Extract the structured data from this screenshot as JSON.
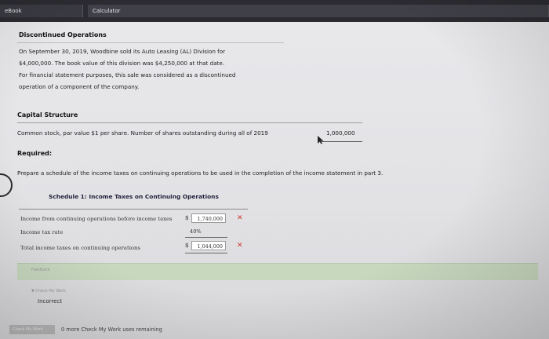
{
  "tabs": {
    "ebook": "eBook",
    "calculator": "Calculator"
  },
  "discontinued": {
    "heading": "Discontinued Operations",
    "lines": [
      "On September 30, 2019, Woodbine sold its Auto Leasing (AL) Division for",
      "$4,000,000. The book value of this division was $4,250,000 at that date.",
      "For financial statement purposes, this sale was considered as a discontinued",
      "operation of a component of the company."
    ]
  },
  "capital": {
    "heading": "Capital Structure",
    "row_label": "Common stock, par value $1 per share. Number of shares outstanding during all of 2019",
    "row_value": "1,000,000"
  },
  "required": {
    "heading": "Required:",
    "text": "Prepare a schedule of the income taxes on continuing operations to be used in the completion of the income statement in part 3."
  },
  "schedule": {
    "title": "Schedule 1: Income Taxes on Continuing Operations",
    "rows": [
      {
        "label": "Income from continuing operations before income taxes",
        "currency": "$",
        "value": "1,740,000",
        "mark": "✕"
      },
      {
        "label": "Income tax rate",
        "value": "40%"
      },
      {
        "label": "Total income taxes on continuing operations",
        "currency": "$",
        "value": "1,044,000",
        "mark": "✕"
      }
    ]
  },
  "feedback": {
    "label": "Feedback",
    "check_label": "▼ Check My Work",
    "result": "Incorrect"
  },
  "footer": {
    "button": "Check My Work",
    "remaining": "0 more Check My Work uses remaining"
  },
  "colors": {
    "error_mark": "#d0342c",
    "feedback_bar": "#c8d8bf"
  }
}
